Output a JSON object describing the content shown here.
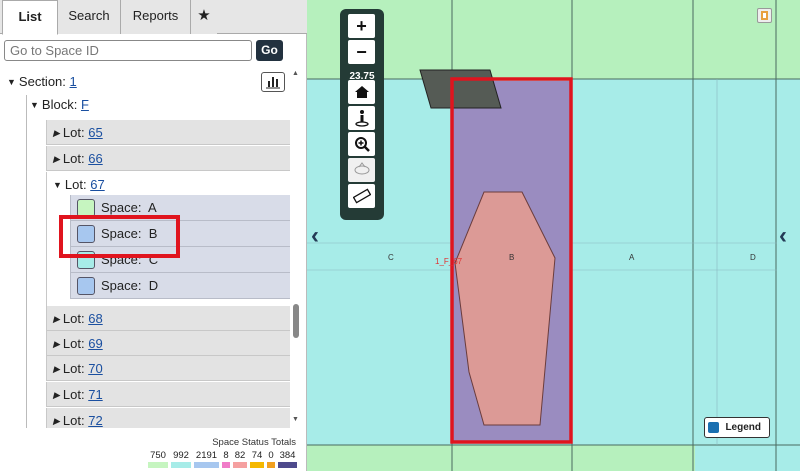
{
  "tabs": [
    {
      "label": "List"
    },
    {
      "label": "Search"
    },
    {
      "label": "Reports"
    },
    {
      "label": "★"
    }
  ],
  "search": {
    "placeholder": "Go to Space ID",
    "go_label": "Go"
  },
  "tree": {
    "section_label": "Section:",
    "section_value": "1",
    "block_label": "Block:",
    "block_value": "F",
    "lot_label": "Lot:",
    "space_label": "Space:",
    "lots_before": [
      "65",
      "66"
    ],
    "open_lot": "67",
    "spaces": [
      {
        "name": "A",
        "color": "#c6f5c0"
      },
      {
        "name": "B",
        "color": "#a7c7ef"
      },
      {
        "name": "C",
        "color": "#a7ece8"
      },
      {
        "name": "D",
        "color": "#a7c7ef"
      }
    ],
    "lots_after": [
      "68",
      "69",
      "70",
      "71",
      "72"
    ]
  },
  "totals": {
    "title": "Space Status Totals",
    "items": [
      {
        "value": "750",
        "color": "#c6f5c0"
      },
      {
        "value": "992",
        "color": "#a7ece8"
      },
      {
        "value": "2191",
        "color": "#a7c7ef"
      },
      {
        "value": "8",
        "color": "#f07cc8"
      },
      {
        "value": "82",
        "color": "#f5a0a0"
      },
      {
        "value": "74",
        "color": "#f5b800"
      },
      {
        "value": "0",
        "color": "#f2a020"
      },
      {
        "value": "384",
        "color": "#4e4a8c"
      }
    ]
  },
  "map": {
    "zoom_level": "23.75",
    "zoom_in": "+",
    "zoom_out": "−",
    "columns": [
      "C",
      "B",
      "A",
      "D"
    ],
    "feature_label": "1_F_67",
    "legend_label": "Legend",
    "colors": {
      "green": "#b6f0bd",
      "cyan": "#a7ece8",
      "selection": "#9a8cc0",
      "highlight": "#e0141e",
      "shape": "#dc9a96"
    }
  }
}
